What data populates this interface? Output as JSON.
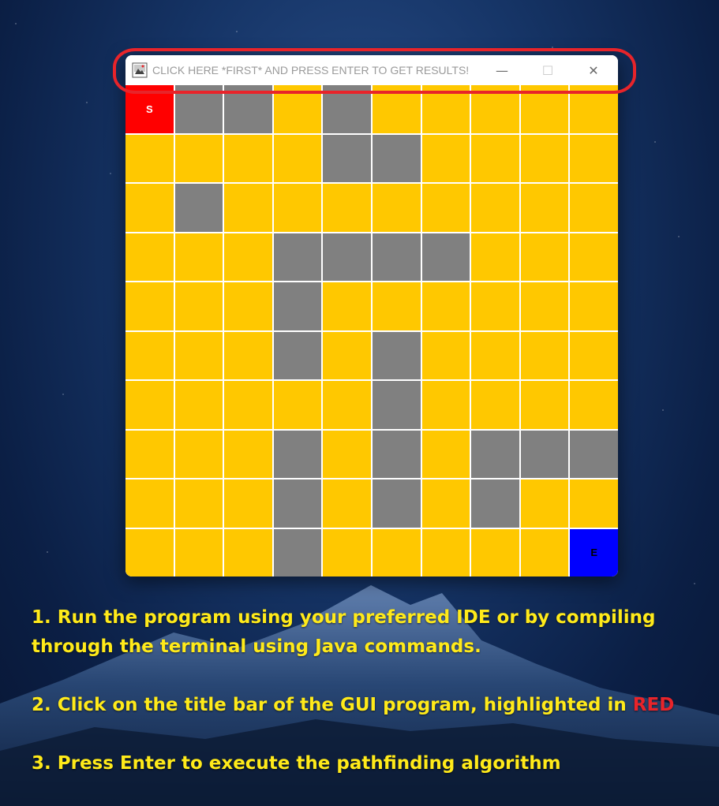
{
  "window": {
    "title": "CLICK HERE *FIRST* AND PRESS ENTER TO GET RESULTS!",
    "controls": {
      "minimize": "—",
      "maximize": "☐",
      "close": "✕"
    }
  },
  "grid": {
    "rows": 10,
    "cols": 10,
    "legend": {
      "S": "start",
      "E": "end",
      "#": "wall",
      ".": "open"
    },
    "cells": [
      "S##.#.....",
      "....##....",
      ".#........",
      "...####...",
      "...#......",
      "...#.#....",
      ".....#....",
      "...#.#.###",
      "...#.#.#..",
      "...#.....E"
    ],
    "start_label": "S",
    "end_label": "E",
    "colors": {
      "open": "#ffc800",
      "wall": "#808080",
      "start": "#ff0000",
      "end": "#0000ff"
    }
  },
  "highlight_color": "#e8242a",
  "instructions": {
    "step1_line1": "1. Run the program using your preferred IDE or by compiling",
    "step1_line2": "through the terminal using Java commands.",
    "step2_prefix": "2. Click on the title bar of the GUI program, highlighted in ",
    "step2_highlight": "RED",
    "step3": "3. Press Enter to execute the pathfinding algorithm"
  }
}
